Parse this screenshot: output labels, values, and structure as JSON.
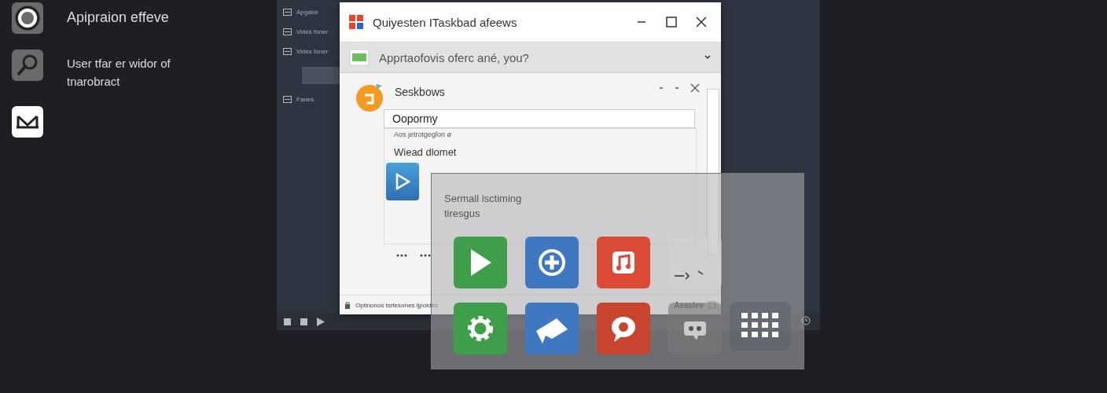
{
  "desktop_items": [
    {
      "label": "Apipraion effeve"
    },
    {
      "label": "User tfar er widor of tnarobract"
    }
  ],
  "background_window": {
    "sidebar": [
      {
        "label": "Apgator"
      },
      {
        "label": "Vides foner"
      },
      {
        "label": "Vides foner"
      },
      {
        "label": "Fanes"
      }
    ]
  },
  "dialog": {
    "title": "Quiyesten ITaskbad afeews",
    "dropdown": "Apprtaofovis oferc ané, you?",
    "panel": {
      "title": "Seskbows",
      "field_value": "Oopormy",
      "hint": "Aos jetrotgeglon ø",
      "label": "Wiead dlomet"
    },
    "status_bar": {
      "left": "Optinonos tsrtelomes ljpoides",
      "right": "Aeasiee"
    }
  },
  "app_panel": {
    "title": "Sermall isctiming tiresgus"
  }
}
